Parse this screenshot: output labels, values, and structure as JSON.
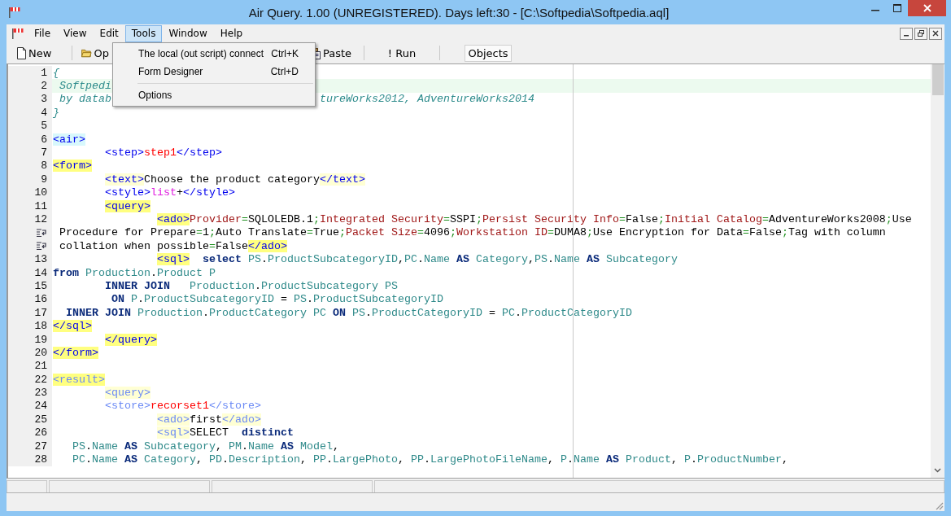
{
  "window": {
    "title": "Air Query. 1.00 (UNREGISTERED). Days left:30 - [C:\\Softpedia\\Softpedia.aql]"
  },
  "menu": [
    {
      "label": "File",
      "selected": false
    },
    {
      "label": "View",
      "selected": false
    },
    {
      "label": "Edit",
      "selected": false
    },
    {
      "label": "Tools",
      "selected": true
    },
    {
      "label": "Window",
      "selected": false
    },
    {
      "label": "Help",
      "selected": false
    }
  ],
  "toolbar": [
    {
      "kind": "doc",
      "label": "New",
      "pressed": false
    },
    {
      "kind": "separator"
    },
    {
      "kind": "folder",
      "label": "Op",
      "pressed": false
    },
    {
      "kind": "clipboard",
      "label": "Paste",
      "pressed": false
    },
    {
      "kind": "separator"
    },
    {
      "kind": "plain",
      "label": "! Run",
      "pressed": false
    },
    {
      "kind": "separator"
    },
    {
      "kind": "plain",
      "label": "Objects",
      "pressed": true
    }
  ],
  "dropdown": [
    {
      "kind": "item",
      "label": "The local (out script) connect",
      "shortcut": "Ctrl+K"
    },
    {
      "kind": "item",
      "label": "Form Designer",
      "shortcut": "Ctrl+D"
    },
    {
      "kind": "separator"
    },
    {
      "kind": "item",
      "label": "Options"
    }
  ],
  "editor": {
    "lines": [
      {
        "kind": "line",
        "number": "1",
        "current": false,
        "tokens": [
          {
            "kind": "comment",
            "text": "{"
          }
        ]
      },
      {
        "kind": "line",
        "number": "2",
        "current": true,
        "tokens": [
          {
            "kind": "comment",
            "text": " Softpedi"
          }
        ]
      },
      {
        "kind": "line",
        "number": "3",
        "current": false,
        "tokens": [
          {
            "kind": "comment",
            "text": " by datab"
          },
          {
            "kind": "comment-after-menu",
            "text": "tureWorks2012, AdventureWorks2014"
          }
        ]
      },
      {
        "kind": "line",
        "number": "4",
        "current": false,
        "tokens": [
          {
            "kind": "comment",
            "text": "}"
          }
        ]
      },
      {
        "kind": "line",
        "number": "5"
      },
      {
        "kind": "line",
        "number": "6",
        "current": false,
        "tokens": [
          {
            "kind": "tag-cyan",
            "text": "<air>"
          }
        ]
      },
      {
        "kind": "line",
        "number": "7",
        "current": false,
        "tokens": [
          {
            "kind": "tag",
            "text": "        <step>"
          },
          {
            "kind": "red",
            "text": "step1"
          },
          {
            "kind": "tag",
            "text": "</step>"
          }
        ]
      },
      {
        "kind": "line",
        "number": "8",
        "current": false,
        "tokens": [
          {
            "kind": "tag-yellow",
            "text": "<form>"
          }
        ]
      },
      {
        "kind": "line",
        "number": "9",
        "current": false,
        "tokens": [
          {
            "kind": "tag-pale",
            "text": "        <text>"
          },
          {
            "kind": "plain",
            "text": "Choose the product category"
          },
          {
            "kind": "tag-pale",
            "text": "</text>"
          }
        ]
      },
      {
        "kind": "line",
        "number": "10",
        "current": false,
        "tokens": [
          {
            "kind": "tag",
            "text": "        <style>"
          },
          {
            "kind": "magenta",
            "text": "list"
          },
          {
            "kind": "plain",
            "text": "+"
          },
          {
            "kind": "tag",
            "text": "</style>"
          }
        ]
      },
      {
        "kind": "line",
        "number": "11",
        "current": false,
        "tokens": [
          {
            "kind": "tag-yellow",
            "text": "        <query>"
          }
        ]
      },
      {
        "kind": "line",
        "number": "12",
        "current": false,
        "tokens": [
          {
            "kind": "tag-yellow",
            "text": "                <ado>"
          },
          {
            "kind": "key",
            "text": "Provider"
          },
          {
            "kind": "op",
            "text": "="
          },
          {
            "kind": "plain",
            "text": "SQLOLEDB.1"
          },
          {
            "kind": "op",
            "text": ";"
          },
          {
            "kind": "key",
            "text": "Integrated Security"
          },
          {
            "kind": "op",
            "text": "="
          },
          {
            "kind": "plain",
            "text": "SSPI"
          },
          {
            "kind": "op",
            "text": ";"
          },
          {
            "kind": "key",
            "text": "Persist Security Info"
          },
          {
            "kind": "op",
            "text": "="
          },
          {
            "kind": "plain",
            "text": "False"
          },
          {
            "kind": "op",
            "text": ";"
          },
          {
            "kind": "key",
            "text": "Initial Catalog"
          },
          {
            "kind": "op",
            "text": "="
          },
          {
            "kind": "plain",
            "text": "AdventureWorks2008"
          },
          {
            "kind": "op",
            "text": ";"
          },
          {
            "kind": "plain",
            "text": "Use"
          }
        ]
      },
      {
        "kind": "wrap",
        "current": false,
        "tokens": [
          {
            "kind": "plain",
            "text": " Procedure for Prepare"
          },
          {
            "kind": "op",
            "text": "="
          },
          {
            "kind": "plain",
            "text": "1"
          },
          {
            "kind": "op",
            "text": ";"
          },
          {
            "kind": "plain",
            "text": "Auto Translate"
          },
          {
            "kind": "op",
            "text": "="
          },
          {
            "kind": "plain",
            "text": "True"
          },
          {
            "kind": "op",
            "text": ";"
          },
          {
            "kind": "key",
            "text": "Packet Size"
          },
          {
            "kind": "op",
            "text": "="
          },
          {
            "kind": "plain",
            "text": "4096"
          },
          {
            "kind": "op",
            "text": ";"
          },
          {
            "kind": "key",
            "text": "Workstation ID"
          },
          {
            "kind": "op",
            "text": "="
          },
          {
            "kind": "plain",
            "text": "DUMA8"
          },
          {
            "kind": "op",
            "text": ";"
          },
          {
            "kind": "plain",
            "text": "Use Encryption for Data"
          },
          {
            "kind": "op",
            "text": "="
          },
          {
            "kind": "plain",
            "text": "False"
          },
          {
            "kind": "op",
            "text": ";"
          },
          {
            "kind": "plain",
            "text": "Tag with column"
          }
        ]
      },
      {
        "kind": "wrap",
        "current": false,
        "tokens": [
          {
            "kind": "plain",
            "text": " collation when possible"
          },
          {
            "kind": "op",
            "text": "="
          },
          {
            "kind": "plain",
            "text": "False"
          },
          {
            "kind": "tag-yellow",
            "text": "</ado>"
          }
        ]
      },
      {
        "kind": "line",
        "number": "13",
        "current": false,
        "tokens": [
          {
            "kind": "tag-yellow",
            "text": "                <sql>  "
          },
          {
            "kind": "keyword",
            "text": "select "
          },
          {
            "kind": "name",
            "text": "PS"
          },
          {
            "kind": "plain",
            "text": "."
          },
          {
            "kind": "name",
            "text": "ProductSubcategoryID"
          },
          {
            "kind": "plain",
            "text": ","
          },
          {
            "kind": "name",
            "text": "PC"
          },
          {
            "kind": "plain",
            "text": "."
          },
          {
            "kind": "name",
            "text": "Name "
          },
          {
            "kind": "keyword",
            "text": "AS "
          },
          {
            "kind": "name",
            "text": "Category"
          },
          {
            "kind": "plain",
            "text": ","
          },
          {
            "kind": "name",
            "text": "PS"
          },
          {
            "kind": "plain",
            "text": "."
          },
          {
            "kind": "name",
            "text": "Name "
          },
          {
            "kind": "keyword",
            "text": "AS "
          },
          {
            "kind": "name",
            "text": "Subcategory"
          }
        ]
      },
      {
        "kind": "line",
        "number": "14",
        "current": false,
        "tokens": [
          {
            "kind": "keyword",
            "text": "from "
          },
          {
            "kind": "name",
            "text": "Production"
          },
          {
            "kind": "plain",
            "text": "."
          },
          {
            "kind": "name",
            "text": "Product P"
          }
        ]
      },
      {
        "kind": "line",
        "number": "15",
        "current": false,
        "tokens": [
          {
            "kind": "keyword",
            "text": "        INNER JOIN   "
          },
          {
            "kind": "name",
            "text": "Production"
          },
          {
            "kind": "plain",
            "text": "."
          },
          {
            "kind": "name",
            "text": "ProductSubcategory PS"
          }
        ]
      },
      {
        "kind": "line",
        "number": "16",
        "current": false,
        "tokens": [
          {
            "kind": "keyword",
            "text": "         ON "
          },
          {
            "kind": "name",
            "text": "P"
          },
          {
            "kind": "plain",
            "text": "."
          },
          {
            "kind": "name",
            "text": "ProductSubcategoryID"
          },
          {
            "kind": "plain",
            "text": " = "
          },
          {
            "kind": "name",
            "text": "PS"
          },
          {
            "kind": "plain",
            "text": "."
          },
          {
            "kind": "name",
            "text": "ProductSubcategoryID"
          }
        ]
      },
      {
        "kind": "line",
        "number": "17",
        "current": false,
        "tokens": [
          {
            "kind": "keyword",
            "text": "  INNER JOIN "
          },
          {
            "kind": "name",
            "text": "Production"
          },
          {
            "kind": "plain",
            "text": "."
          },
          {
            "kind": "name",
            "text": "ProductCategory PC "
          },
          {
            "kind": "keyword",
            "text": "ON "
          },
          {
            "kind": "name",
            "text": "PS"
          },
          {
            "kind": "plain",
            "text": "."
          },
          {
            "kind": "name",
            "text": "ProductCategoryID"
          },
          {
            "kind": "plain",
            "text": " = "
          },
          {
            "kind": "name",
            "text": "PC"
          },
          {
            "kind": "plain",
            "text": "."
          },
          {
            "kind": "name",
            "text": "ProductCategoryID"
          }
        ]
      },
      {
        "kind": "line",
        "number": "18",
        "current": false,
        "tokens": [
          {
            "kind": "tag-yellow",
            "text": "</sql>"
          }
        ]
      },
      {
        "kind": "line",
        "number": "19",
        "current": false,
        "tokens": [
          {
            "kind": "tag-yellow",
            "text": "        </query>"
          }
        ]
      },
      {
        "kind": "line",
        "number": "20",
        "current": false,
        "tokens": [
          {
            "kind": "tag-yellow",
            "text": "</form>"
          }
        ]
      },
      {
        "kind": "line",
        "number": "21"
      },
      {
        "kind": "line",
        "number": "22",
        "current": false,
        "tokens": [
          {
            "kind": "tag2-yellow",
            "text": "<result>"
          }
        ]
      },
      {
        "kind": "line",
        "number": "23",
        "current": false,
        "tokens": [
          {
            "kind": "tag2-pale",
            "text": "        <query>"
          }
        ]
      },
      {
        "kind": "line",
        "number": "24",
        "current": false,
        "tokens": [
          {
            "kind": "tag2",
            "text": "        <store>"
          },
          {
            "kind": "red",
            "text": "recorset1"
          },
          {
            "kind": "tag2",
            "text": "</store>"
          }
        ]
      },
      {
        "kind": "line",
        "number": "25",
        "current": false,
        "tokens": [
          {
            "kind": "tag2-pale",
            "text": "                <ado>"
          },
          {
            "kind": "plain",
            "text": "first"
          },
          {
            "kind": "tag2-pale",
            "text": "</ado>"
          }
        ]
      },
      {
        "kind": "line",
        "number": "26",
        "current": false,
        "tokens": [
          {
            "kind": "tag2-pale",
            "text": "                <sql>"
          },
          {
            "kind": "plain",
            "text": "SELECT  "
          },
          {
            "kind": "keyword",
            "text": "distinct"
          }
        ]
      },
      {
        "kind": "line",
        "number": "27",
        "current": false,
        "tokens": [
          {
            "kind": "name",
            "text": "   PS"
          },
          {
            "kind": "plain",
            "text": "."
          },
          {
            "kind": "name",
            "text": "Name "
          },
          {
            "kind": "keyword",
            "text": "AS "
          },
          {
            "kind": "name",
            "text": "Subcategory"
          },
          {
            "kind": "plain",
            "text": ", "
          },
          {
            "kind": "name",
            "text": "PM"
          },
          {
            "kind": "plain",
            "text": "."
          },
          {
            "kind": "name",
            "text": "Name "
          },
          {
            "kind": "keyword",
            "text": "AS "
          },
          {
            "kind": "name",
            "text": "Model"
          },
          {
            "kind": "plain",
            "text": ","
          }
        ]
      },
      {
        "kind": "line",
        "number": "28",
        "current": false,
        "tokens": [
          {
            "kind": "name",
            "text": "   PC"
          },
          {
            "kind": "plain",
            "text": "."
          },
          {
            "kind": "name",
            "text": "Name "
          },
          {
            "kind": "keyword",
            "text": "AS "
          },
          {
            "kind": "name",
            "text": "Category"
          },
          {
            "kind": "plain",
            "text": ", "
          },
          {
            "kind": "name",
            "text": "PD"
          },
          {
            "kind": "plain",
            "text": "."
          },
          {
            "kind": "name",
            "text": "Description"
          },
          {
            "kind": "plain",
            "text": ", "
          },
          {
            "kind": "name",
            "text": "PP"
          },
          {
            "kind": "plain",
            "text": "."
          },
          {
            "kind": "name",
            "text": "LargePhoto"
          },
          {
            "kind": "plain",
            "text": ", "
          },
          {
            "kind": "name",
            "text": "PP"
          },
          {
            "kind": "plain",
            "text": "."
          },
          {
            "kind": "name",
            "text": "LargePhotoFileName"
          },
          {
            "kind": "plain",
            "text": ", "
          },
          {
            "kind": "name",
            "text": "P"
          },
          {
            "kind": "plain",
            "text": "."
          },
          {
            "kind": "name",
            "text": "Name "
          },
          {
            "kind": "keyword",
            "text": "AS "
          },
          {
            "kind": "name",
            "text": "Product"
          },
          {
            "kind": "plain",
            "text": ", "
          },
          {
            "kind": "name",
            "text": "P"
          },
          {
            "kind": "plain",
            "text": "."
          },
          {
            "kind": "name",
            "text": "ProductNumber"
          },
          {
            "kind": "plain",
            "text": ","
          }
        ]
      }
    ]
  }
}
